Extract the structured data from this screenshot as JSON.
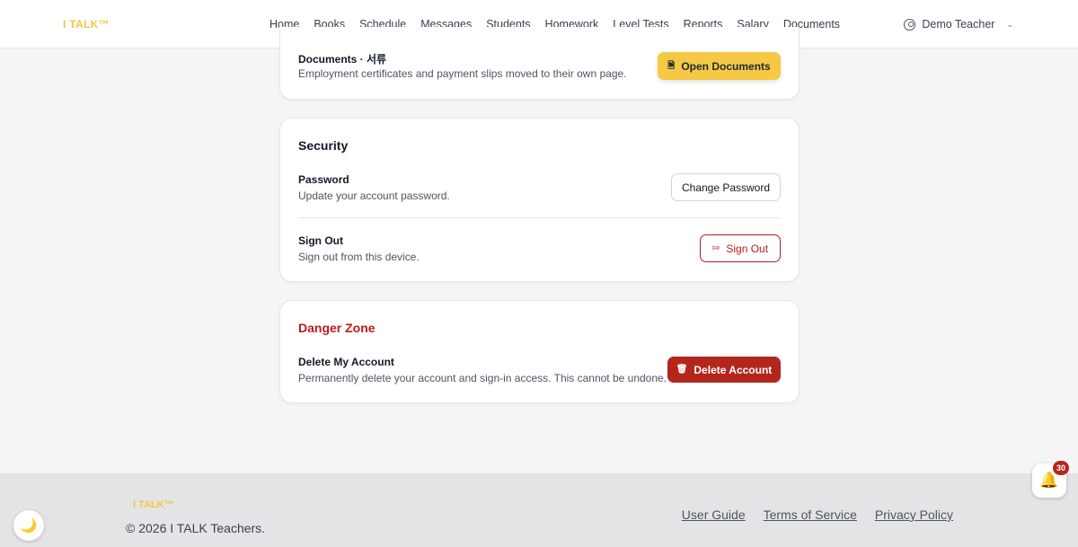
{
  "brand": {
    "logo": "I TALK™"
  },
  "nav": {
    "items": [
      "Home",
      "Books",
      "Schedule",
      "Messages",
      "Students",
      "Homework",
      "Level Tests",
      "Reports",
      "Salary",
      "Documents"
    ]
  },
  "user": {
    "name": "Demo Teacher",
    "icon": "user-circle-icon"
  },
  "documents_card": {
    "title": "Documents · 서류",
    "description": "Employment certificates and payment slips moved to their own page.",
    "button_label": "Open Documents",
    "button_icon": "document-icon"
  },
  "security_card": {
    "heading": "Security",
    "password": {
      "title": "Password",
      "description": "Update your account password.",
      "button_label": "Change Password"
    },
    "signout": {
      "title": "Sign Out",
      "description": "Sign out from this device.",
      "button_label": "Sign Out",
      "button_icon": "logout-icon"
    }
  },
  "danger_card": {
    "heading": "Danger Zone",
    "delete": {
      "title": "Delete My Account",
      "description": "Permanently delete your account and sign-in access. This cannot be undone.",
      "button_label": "Delete Account",
      "button_icon": "trash-icon"
    }
  },
  "footer": {
    "logo": "I TALK™",
    "copyright": "© 2026 I TALK Teachers.",
    "links": [
      "User Guide",
      "Terms of Service",
      "Privacy Policy"
    ]
  },
  "floating": {
    "theme_icon": "moon-icon",
    "bell_icon": "bell-icon",
    "notification_count": "30"
  },
  "colors": {
    "accent": "#f6c945",
    "danger": "#b3261e",
    "background": "#f5f5f7"
  }
}
